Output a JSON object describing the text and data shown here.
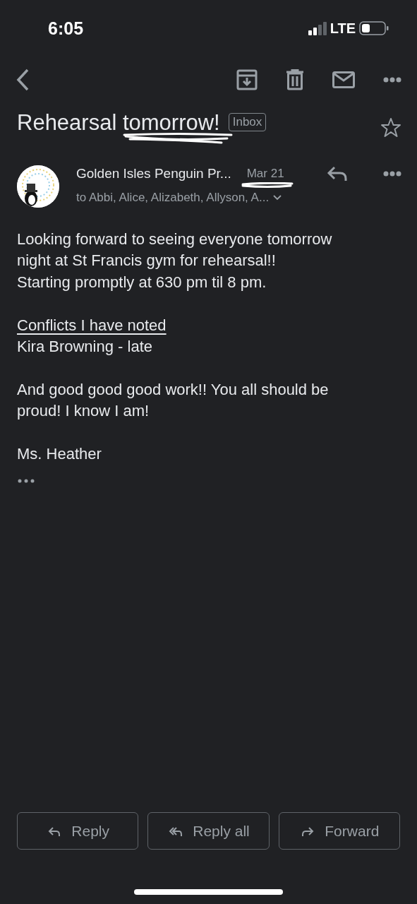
{
  "status_bar": {
    "time": "6:05",
    "network": "LTE"
  },
  "subject": {
    "title_start": "Rehearsal ",
    "title_marked": "tomorrow!",
    "label": "Inbox",
    "starred": false
  },
  "message": {
    "sender": "Golden Isles Penguin Pr...",
    "date": "Mar 21",
    "recipients": "to Abbi, Alice, Alizabeth, Allyson, A...",
    "paragraphs": [
      {
        "lines": [
          {
            "text": "Looking forward to seeing everyone tomorrow",
            "underlined": false
          },
          {
            "text": "night at St Francis gym for rehearsal!!",
            "underlined": false
          },
          {
            "text": "Starting promptly at 630 pm til 8 pm.",
            "underlined": false
          }
        ]
      },
      {
        "lines": [
          {
            "text": "Conflicts I have noted",
            "underlined": true
          },
          {
            "text": "Kira Browning - late",
            "underlined": false
          }
        ]
      },
      {
        "lines": [
          {
            "text": "And good good good work!! You all should be",
            "underlined": false
          },
          {
            "text": "proud! I know I am!",
            "underlined": false
          }
        ]
      },
      {
        "lines": [
          {
            "text": "Ms. Heather",
            "underlined": false
          }
        ]
      }
    ]
  },
  "actions": [
    {
      "kind": "reply",
      "label": "Reply"
    },
    {
      "kind": "reply_all",
      "label": "Reply all"
    },
    {
      "kind": "forward",
      "label": "Forward"
    }
  ]
}
